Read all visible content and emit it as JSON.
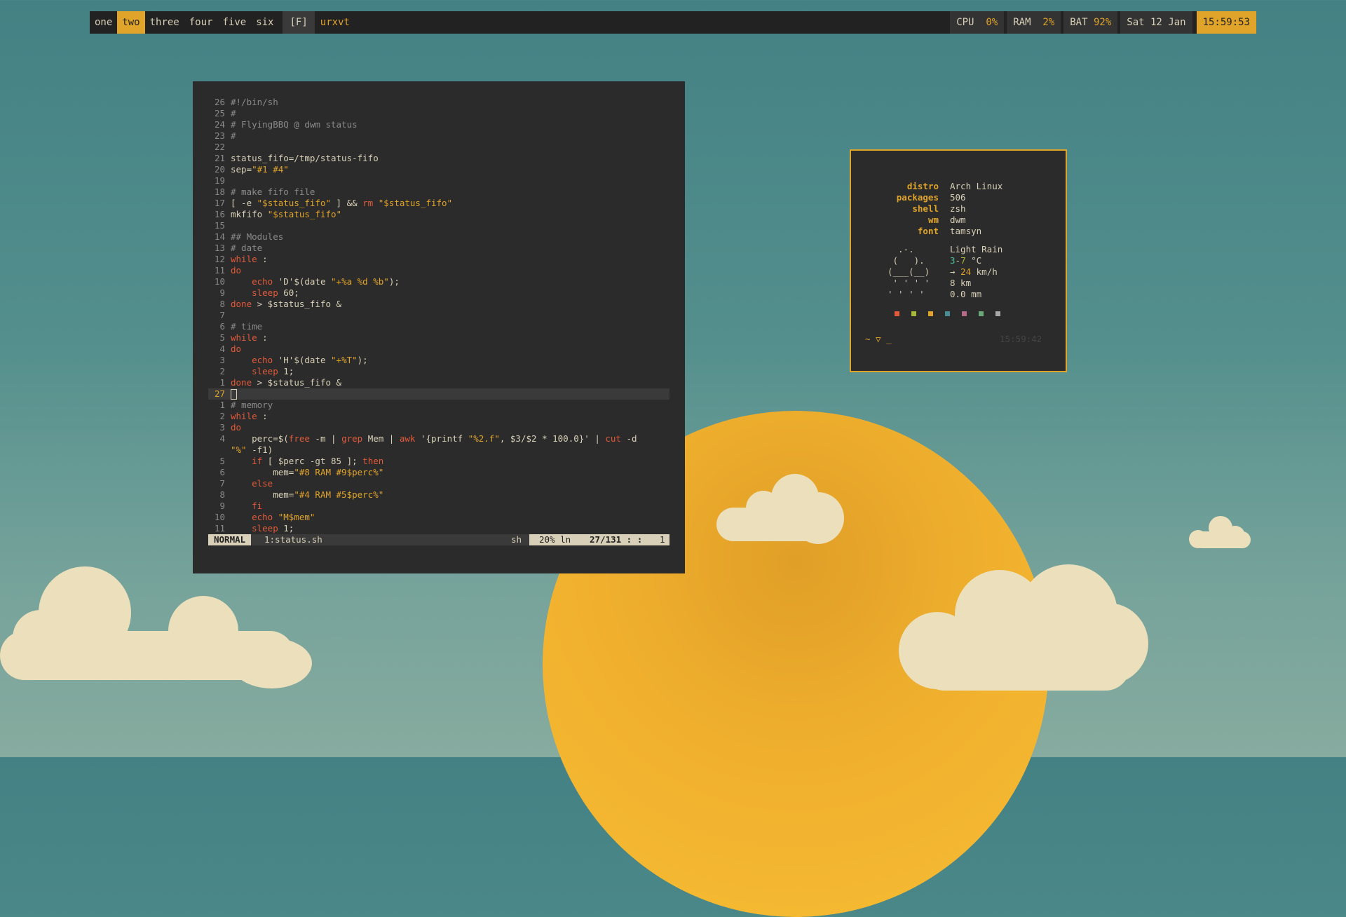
{
  "bar": {
    "tags": [
      "one",
      "two",
      "three",
      "four",
      "five",
      "six"
    ],
    "selected_tag": "two",
    "layout": "[F]",
    "window_title": "urxvt",
    "cpu_label": "CPU",
    "cpu_value": "0%",
    "ram_label": "RAM",
    "ram_value": "2%",
    "bat_label": "BAT",
    "bat_value": "92%",
    "date": "Sat 12 Jan",
    "clock": "15:59:53"
  },
  "editor": {
    "lines": [
      {
        "num": "26",
        "text": "#!/bin/sh"
      },
      {
        "num": "25",
        "text": "#"
      },
      {
        "num": "24",
        "text": "# FlyingBBQ @ dwm status"
      },
      {
        "num": "23",
        "text": "#"
      },
      {
        "num": "22",
        "text": ""
      },
      {
        "num": "21",
        "text": "status_fifo=/tmp/status-fifo"
      },
      {
        "num": "20",
        "text": "sep=\"#1 #4\""
      },
      {
        "num": "19",
        "text": ""
      },
      {
        "num": "18",
        "text": "# make fifo file"
      },
      {
        "num": "17",
        "text": "[ -e \"$status_fifo\" ] && rm \"$status_fifo\""
      },
      {
        "num": "16",
        "text": "mkfifo \"$status_fifo\""
      },
      {
        "num": "15",
        "text": ""
      },
      {
        "num": "14",
        "text": "## Modules"
      },
      {
        "num": "13",
        "text": "# date"
      },
      {
        "num": "12",
        "text": "while :"
      },
      {
        "num": "11",
        "text": "do"
      },
      {
        "num": "10",
        "text": "    echo 'D'$(date \"+%a %d %b\");"
      },
      {
        "num": "9",
        "text": "    sleep 60;"
      },
      {
        "num": "8",
        "text": "done > $status_fifo &"
      },
      {
        "num": "7",
        "text": ""
      },
      {
        "num": "6",
        "text": "# time"
      },
      {
        "num": "5",
        "text": "while :"
      },
      {
        "num": "4",
        "text": "do"
      },
      {
        "num": "3",
        "text": "    echo 'H'$(date \"+%T\");"
      },
      {
        "num": "2",
        "text": "    sleep 1;"
      },
      {
        "num": "1",
        "text": "done > $status_fifo &"
      },
      {
        "num": "27",
        "text": ""
      },
      {
        "num": "1",
        "text": "# memory"
      },
      {
        "num": "2",
        "text": "while :"
      },
      {
        "num": "3",
        "text": "do"
      },
      {
        "num": "4",
        "text": "    perc=$(free -m | grep Mem | awk '{printf \"%2.f\", $3/$2 * 100.0}' | cut -d"
      },
      {
        "num": "",
        "text": "\"%\" -f1)"
      },
      {
        "num": "5",
        "text": "    if [ $perc -gt 85 ]; then"
      },
      {
        "num": "6",
        "text": "        mem=\"#8 RAM #9$perc%\""
      },
      {
        "num": "7",
        "text": "    else"
      },
      {
        "num": "8",
        "text": "        mem=\"#4 RAM #5$perc%\""
      },
      {
        "num": "9",
        "text": "    fi"
      },
      {
        "num": "10",
        "text": "    echo \"M$mem\""
      },
      {
        "num": "11",
        "text": "    sleep 1;"
      }
    ],
    "mode": "NORMAL",
    "buffer": "1:status.sh",
    "filetype": "sh",
    "percent": "20% ln",
    "position": "27/131 : :",
    "column": "1"
  },
  "fetch": {
    "info": [
      {
        "label": "distro",
        "value": "Arch Linux"
      },
      {
        "label": "packages",
        "value": "506"
      },
      {
        "label": "shell",
        "value": "zsh"
      },
      {
        "label": "wm",
        "value": "dwm"
      },
      {
        "label": "font",
        "value": "tamsyn"
      }
    ],
    "weather_art": [
      "  .-.   ",
      " (   ). ",
      "(___(__)",
      " ' ' ' '",
      "' ' ' ' "
    ],
    "weather": {
      "condition": "Light Rain",
      "temp_low": "3",
      "temp_high": "7",
      "temp_unit": "°C",
      "wind_arrow": "→",
      "wind_speed": "24",
      "wind_unit": "km/h",
      "visibility": "8 km",
      "precip": "0.0 mm"
    },
    "swatch_colors": [
      "#e15a3a",
      "#a8b838",
      "#e1a42a",
      "#4a8c94",
      "#b66a8a",
      "#6aa87a",
      "#a8a8a8"
    ],
    "prompt": "~ ▽ _",
    "prompt_time": "15:59:42"
  }
}
